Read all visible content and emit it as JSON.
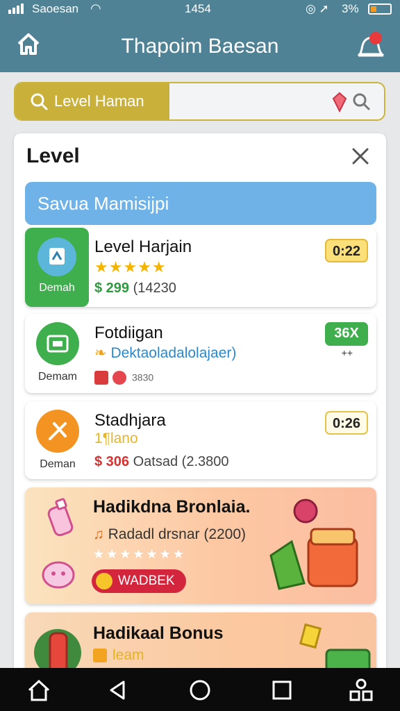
{
  "status_bar": {
    "carrier": "Saoesan",
    "time": "1454",
    "battery": "3%"
  },
  "header": {
    "title": "Thapoim Baesan"
  },
  "search": {
    "pill_label": "Level Haman"
  },
  "panel": {
    "title": "Level",
    "section_label": "Savua Mamisijpi"
  },
  "cards": [
    {
      "tile_label": "Demah",
      "title": "Level Harjain",
      "rating": 5,
      "price": "$ 299",
      "count": "(14230",
      "badge": "0:22"
    },
    {
      "tile_label": "Demam",
      "title": "Fotdiigan",
      "subtitle": "Dektaoladalolajaer)",
      "meta": "3830",
      "badge": "36X",
      "mark": "++"
    },
    {
      "tile_label": "Deman",
      "title": "Stadhjara",
      "subtitle": "1¶lano",
      "price": "$ 306",
      "rest": "Oatsad (2.3800",
      "badge": "0:26"
    },
    {
      "title": "Hadikdna Bronlaia.",
      "subtitle": "Radadl drsnar (2200)",
      "stars": "★★★★★★★",
      "button": "WADBEK"
    },
    {
      "title": "Hadikaal Bonus",
      "subtitle": "leam"
    }
  ],
  "colors": {
    "header": "#4f8294",
    "accent_green": "#3fae4d",
    "accent_blue": "#6eb2e8",
    "accent_orange": "#f39321",
    "promo_red": "#d3263d"
  }
}
